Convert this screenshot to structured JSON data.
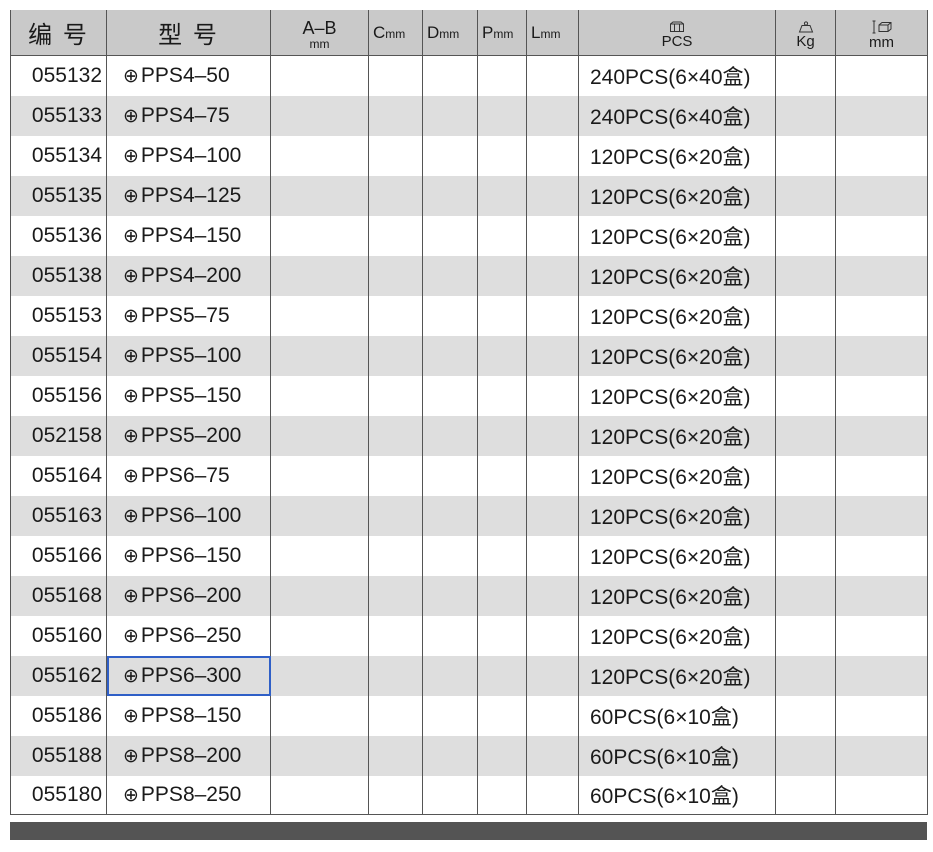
{
  "headers": {
    "code": "编 号",
    "model": "型 号",
    "ab": "A–B",
    "ab_unit": "mm",
    "c_letter": "C",
    "c_unit": "mm",
    "d_letter": "D",
    "d_unit": "mm",
    "p_letter": "P",
    "p_unit": "mm",
    "l_letter": "L",
    "l_unit": "mm",
    "pack": "PCS",
    "weight": "Kg",
    "size": "mm",
    "pack_icon": "boxes-icon",
    "weight_icon": "weight-icon",
    "size_icon": "carton-dimension-icon"
  },
  "rows": [
    {
      "code": "055132",
      "cross": "⊕",
      "model": "PPS4–50",
      "pack": "240PCS(6×40盒)"
    },
    {
      "code": "055133",
      "cross": "⊕",
      "model": "PPS4–75",
      "pack": "240PCS(6×40盒)"
    },
    {
      "code": "055134",
      "cross": "⊕",
      "model": "PPS4–100",
      "pack": "120PCS(6×20盒)"
    },
    {
      "code": "055135",
      "cross": "⊕",
      "model": "PPS4–125",
      "pack": "120PCS(6×20盒)"
    },
    {
      "code": "055136",
      "cross": "⊕",
      "model": "PPS4–150",
      "pack": "120PCS(6×20盒)"
    },
    {
      "code": "055138",
      "cross": "⊕",
      "model": "PPS4–200",
      "pack": "120PCS(6×20盒)"
    },
    {
      "code": "055153",
      "cross": "⊕",
      "model": "PPS5–75",
      "pack": "120PCS(6×20盒)"
    },
    {
      "code": "055154",
      "cross": "⊕",
      "model": "PPS5–100",
      "pack": "120PCS(6×20盒)"
    },
    {
      "code": "055156",
      "cross": "⊕",
      "model": "PPS5–150",
      "pack": "120PCS(6×20盒)"
    },
    {
      "code": "052158",
      "cross": "⊕",
      "model": "PPS5–200",
      "pack": "120PCS(6×20盒)"
    },
    {
      "code": "055164",
      "cross": "⊕",
      "model": "PPS6–75",
      "pack": "120PCS(6×20盒)"
    },
    {
      "code": "055163",
      "cross": "⊕",
      "model": "PPS6–100",
      "pack": "120PCS(6×20盒)"
    },
    {
      "code": "055166",
      "cross": "⊕",
      "model": "PPS6–150",
      "pack": "120PCS(6×20盒)"
    },
    {
      "code": "055168",
      "cross": "⊕",
      "model": "PPS6–200",
      "pack": "120PCS(6×20盒)"
    },
    {
      "code": "055160",
      "cross": "⊕",
      "model": "PPS6–250",
      "pack": "120PCS(6×20盒)"
    },
    {
      "code": "055162",
      "cross": "⊕",
      "model": "PPS6–300",
      "pack": "120PCS(6×20盒)"
    },
    {
      "code": "055186",
      "cross": "⊕",
      "model": "PPS8–150",
      "pack": "60PCS(6×10盒)"
    },
    {
      "code": "055188",
      "cross": "⊕",
      "model": "PPS8–200",
      "pack": "60PCS(6×10盒)"
    },
    {
      "code": "055180",
      "cross": "⊕",
      "model": "PPS8–250",
      "pack": "60PCS(6×10盒)"
    }
  ],
  "selected_row": 15,
  "colors": {
    "header_bg": "#c9c9c9",
    "alt_row_bg": "#dedede",
    "selection": "#2f5fc7",
    "bottom_bar": "#545454"
  }
}
